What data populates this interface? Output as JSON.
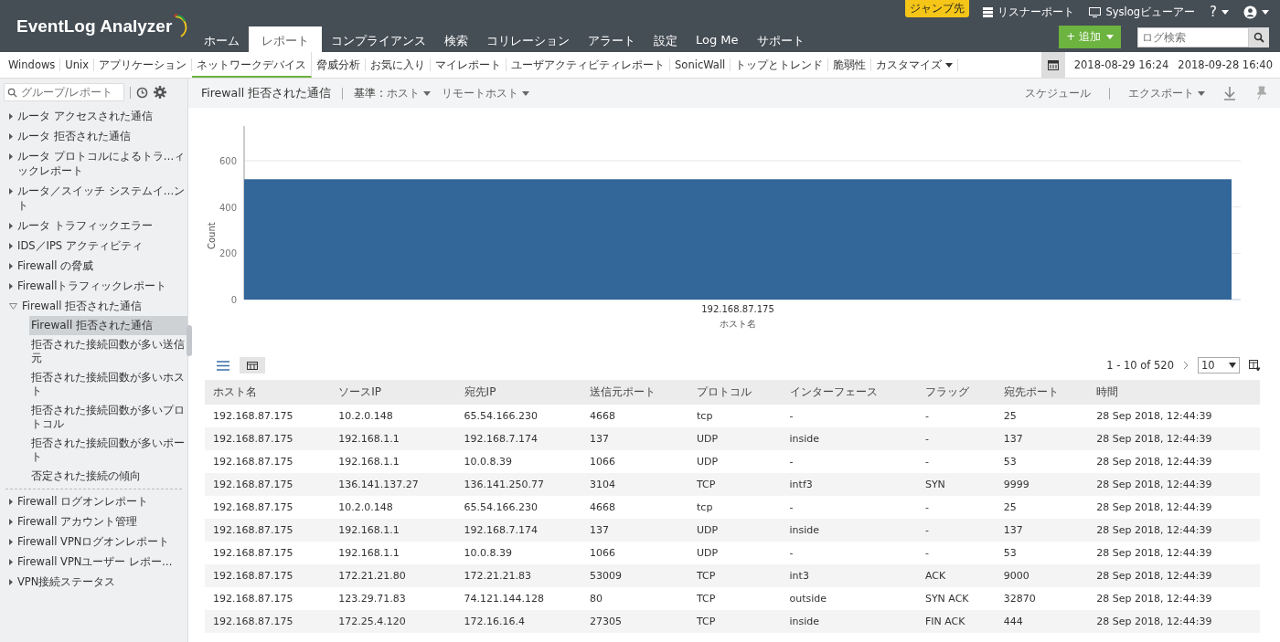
{
  "header": {
    "logo": "EventLog Analyzer",
    "jump_badge": "ジャンプ先",
    "top_links": [
      {
        "kind": "listener",
        "label": "リスナーポート"
      },
      {
        "kind": "syslog",
        "label": "Syslogビューアー"
      },
      {
        "kind": "help",
        "label": "?"
      },
      {
        "kind": "user"
      }
    ],
    "nav": [
      {
        "label": "ホーム",
        "selected": false
      },
      {
        "label": "レポート",
        "selected": true
      },
      {
        "label": "コンプライアンス",
        "selected": false
      },
      {
        "label": "検索",
        "selected": false
      },
      {
        "label": "コリレーション",
        "selected": false
      },
      {
        "label": "アラート",
        "selected": false
      },
      {
        "label": "設定",
        "selected": false
      },
      {
        "label": "Log Me",
        "selected": false
      },
      {
        "label": "サポート",
        "selected": false
      }
    ],
    "add_button": "+ 追加",
    "search": {
      "placeholder": "ログ検索"
    }
  },
  "subtabs": [
    {
      "label": "Windows",
      "selected": false
    },
    {
      "label": "Unix",
      "selected": false
    },
    {
      "label": "アプリケーション",
      "selected": false
    },
    {
      "label": "ネットワークデバイス",
      "selected": true
    },
    {
      "label": "脅威分析",
      "selected": false
    },
    {
      "label": "お気に入り",
      "selected": false
    },
    {
      "label": "マイレポート",
      "selected": false
    },
    {
      "label": "ユーザアクティビティレポート",
      "selected": false
    },
    {
      "label": "SonicWall",
      "selected": false
    },
    {
      "label": "トップとトレンド",
      "selected": false
    },
    {
      "label": "脆弱性",
      "selected": false
    },
    {
      "label": "カスタマイズ",
      "selected": false
    }
  ],
  "date_range": {
    "from": "2018-08-29 16:24",
    "to": "2018-09-28 16:40"
  },
  "sidebar": {
    "search": {
      "placeholder": "グループ/レポート"
    },
    "items": [
      {
        "label": "ルータ アクセスされた通信",
        "expanded": false
      },
      {
        "label": "ルータ 拒否された通信",
        "expanded": false
      },
      {
        "label": "ルータ プロトコルによるトラ…ィックレポート",
        "expanded": false
      },
      {
        "label": "ルータ／スイッチ システムイ…ント",
        "expanded": false
      },
      {
        "label": "ルータ トラフィックエラー",
        "expanded": false
      },
      {
        "label": "IDS／IPS アクティビティ",
        "expanded": false
      },
      {
        "label": "Firewall の脅威",
        "expanded": false
      },
      {
        "label": "Firewallトラフィックレポート",
        "expanded": false
      },
      {
        "label": "Firewall 拒否された通信",
        "expanded": true,
        "children": [
          {
            "label": "Firewall 拒否された通信",
            "selected": true
          },
          {
            "label": "拒否された接続回数が多い送信元",
            "selected": false
          },
          {
            "label": "拒否された接続回数が多いホスト",
            "selected": false
          },
          {
            "label": "拒否された接続回数が多いプロトコル",
            "selected": false
          },
          {
            "label": "拒否された接続回数が多いポート",
            "selected": false
          },
          {
            "label": "否定された接続の傾向",
            "selected": false
          }
        ]
      },
      {
        "label": "Firewall ログオンレポート",
        "expanded": false
      },
      {
        "label": "Firewall アカウント管理",
        "expanded": false
      },
      {
        "label": "Firewall VPNログオンレポート",
        "expanded": false
      },
      {
        "label": "Firewall VPNユーザー レポー…",
        "expanded": false
      },
      {
        "label": "VPN接続ステータス",
        "expanded": false
      }
    ]
  },
  "report": {
    "title": "Firewall 拒否された通信",
    "basis_label": "基準 :",
    "basis_value": "ホスト",
    "remote": "リモートホスト",
    "schedule": "スケジュール",
    "export": "エクスポート",
    "chart_data": {
      "type": "bar",
      "xlabel": "ホスト名",
      "ylabel": "Count",
      "categories": [
        "192.168.87.175"
      ],
      "values": [
        520
      ],
      "ylim": [
        0,
        750
      ],
      "yticks": [
        0,
        200,
        400,
        600
      ],
      "grid": true
    },
    "pagination": "1 - 10 of 520",
    "page_size": "10",
    "table": {
      "columns": [
        "ホスト名",
        "ソースIP",
        "宛先IP",
        "送信元ポート",
        "プロトコル",
        "インターフェース",
        "フラッグ",
        "宛先ポート",
        "時間"
      ],
      "rows": [
        [
          "192.168.87.175",
          "10.2.0.148",
          "65.54.166.230",
          "4668",
          "tcp",
          "-",
          "-",
          "25",
          "28 Sep 2018, 12:44:39"
        ],
        [
          "192.168.87.175",
          "192.168.1.1",
          "192.168.7.174",
          "137",
          "UDP",
          "inside",
          "-",
          "137",
          "28 Sep 2018, 12:44:39"
        ],
        [
          "192.168.87.175",
          "192.168.1.1",
          "10.0.8.39",
          "1066",
          "UDP",
          "-",
          "-",
          "53",
          "28 Sep 2018, 12:44:39"
        ],
        [
          "192.168.87.175",
          "136.141.137.27",
          "136.141.250.77",
          "3104",
          "TCP",
          "intf3",
          "SYN",
          "9999",
          "28 Sep 2018, 12:44:39"
        ],
        [
          "192.168.87.175",
          "10.2.0.148",
          "65.54.166.230",
          "4668",
          "tcp",
          "-",
          "-",
          "25",
          "28 Sep 2018, 12:44:39"
        ],
        [
          "192.168.87.175",
          "192.168.1.1",
          "192.168.7.174",
          "137",
          "UDP",
          "inside",
          "-",
          "137",
          "28 Sep 2018, 12:44:39"
        ],
        [
          "192.168.87.175",
          "192.168.1.1",
          "10.0.8.39",
          "1066",
          "UDP",
          "-",
          "-",
          "53",
          "28 Sep 2018, 12:44:39"
        ],
        [
          "192.168.87.175",
          "172.21.21.80",
          "172.21.21.83",
          "53009",
          "TCP",
          "int3",
          "ACK",
          "9000",
          "28 Sep 2018, 12:44:39"
        ],
        [
          "192.168.87.175",
          "123.29.71.83",
          "74.121.144.128",
          "80",
          "TCP",
          "outside",
          "SYN ACK",
          "32870",
          "28 Sep 2018, 12:44:39"
        ],
        [
          "192.168.87.175",
          "172.25.4.120",
          "172.16.16.4",
          "27305",
          "TCP",
          "inside",
          "FIN ACK",
          "444",
          "28 Sep 2018, 12:44:39"
        ]
      ]
    }
  }
}
